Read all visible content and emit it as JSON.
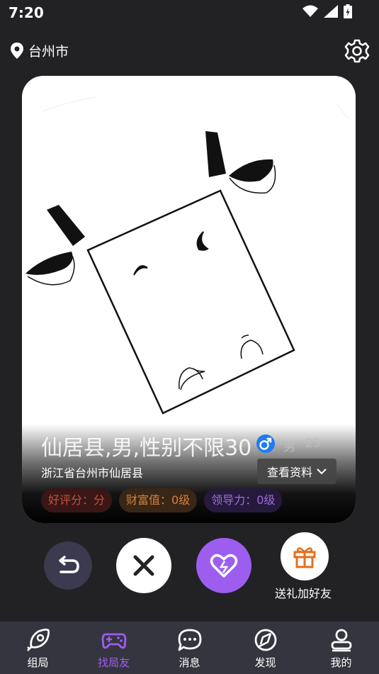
{
  "status_bar": {
    "time": "7:20"
  },
  "location": {
    "city": "台州市"
  },
  "card": {
    "title": "仙居县,男,性别不限30",
    "gender": "男",
    "age": "25",
    "address": "浙江省台州市仙居县",
    "view_profile_label": "查看资料",
    "tags": [
      "好评分：分",
      "财富值：0级",
      "领导力：0级"
    ]
  },
  "actions": {
    "gift_label": "送礼加好友"
  },
  "bottom_nav": {
    "items": [
      {
        "label": "组局",
        "icon": "rocket-icon"
      },
      {
        "label": "找局友",
        "icon": "gamepad-icon"
      },
      {
        "label": "消息",
        "icon": "chat-bubble-icon"
      },
      {
        "label": "发现",
        "icon": "compass-icon"
      },
      {
        "label": "我的",
        "icon": "user-icon"
      }
    ],
    "active_index": 1
  },
  "colors": {
    "background": "#222124",
    "accent": "#9d5ef0",
    "nav_background": "#35353f",
    "male_badge": "#1e7cf0"
  }
}
